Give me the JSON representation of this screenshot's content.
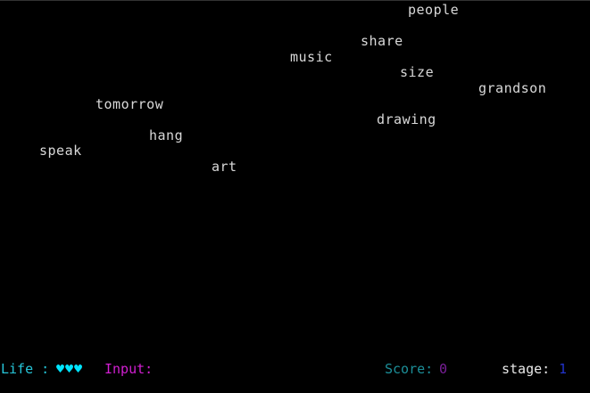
{
  "words": {
    "people": "people",
    "share": "share",
    "music": "music",
    "size": "size",
    "grandson": "grandson",
    "tomorrow": "tomorrow",
    "drawing": "drawing",
    "hang": "hang",
    "speak": "speak",
    "art": "art"
  },
  "hud": {
    "life_label": "Life :",
    "hearts": "♥♥♥",
    "input_label": "Input:",
    "score_label": "Score:",
    "score_value": "0",
    "stage_label": "stage:",
    "stage_value": "1"
  },
  "colors": {
    "background": "#000000",
    "word": "#d9d9d9",
    "life": "#26c6d9",
    "heart": "#00e5ff",
    "input": "#d21fd2",
    "score_label": "#1c8f99",
    "score_value": "#7a1f99",
    "stage_label": "#e8e8e8",
    "stage_value": "#2233cc"
  }
}
